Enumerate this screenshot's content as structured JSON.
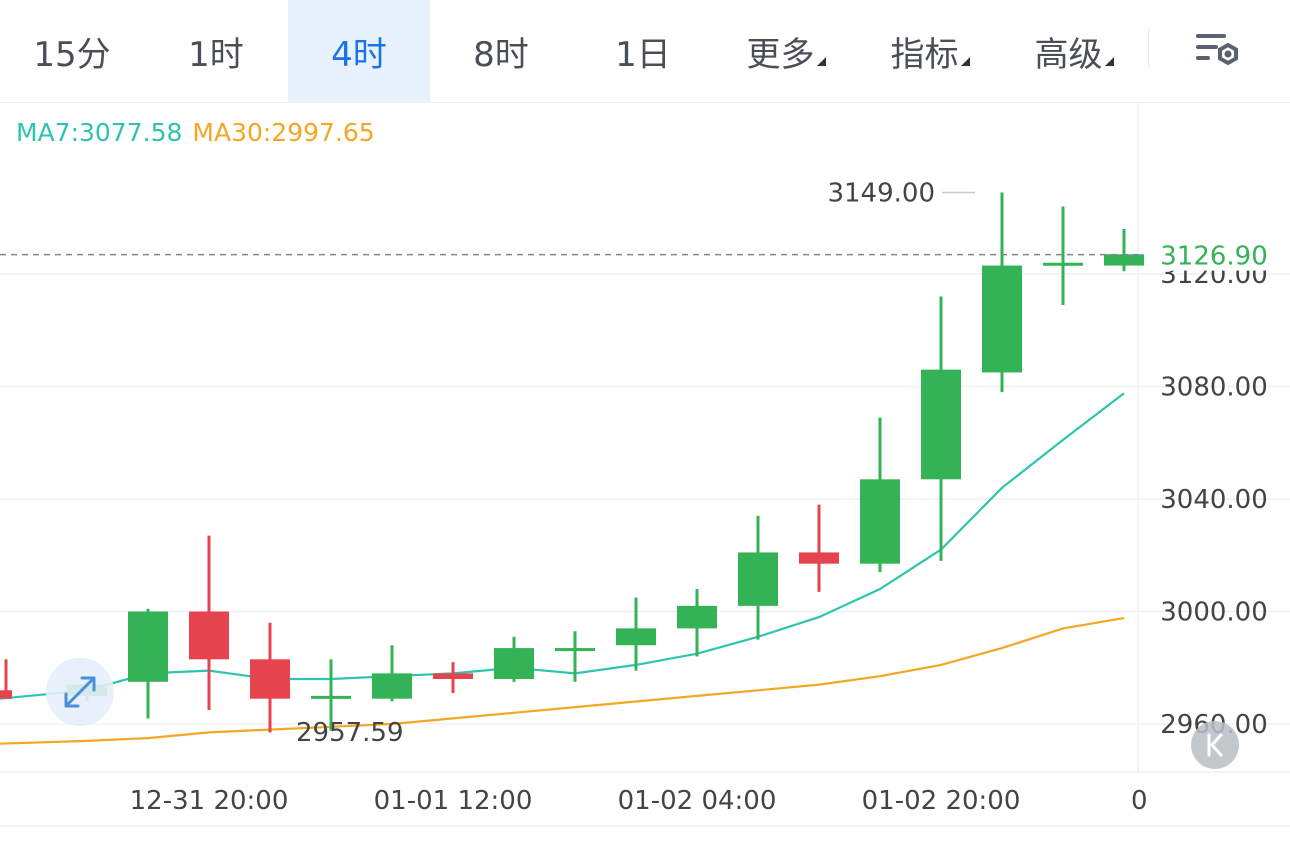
{
  "toolbar": {
    "tabs": [
      {
        "label": "15分",
        "active": false
      },
      {
        "label": "1时",
        "active": false
      },
      {
        "label": "4时",
        "active": true
      },
      {
        "label": "8时",
        "active": false
      },
      {
        "label": "1日",
        "active": false
      },
      {
        "label": "更多",
        "active": false,
        "dropdown": true
      },
      {
        "label": "指标",
        "active": false,
        "dropdown": true
      },
      {
        "label": "高级",
        "active": false,
        "dropdown": true
      }
    ],
    "settings_icon": "chart-settings-icon"
  },
  "legend": {
    "ma7": "MA7:3077.58",
    "ma30": "MA30:2997.65"
  },
  "colors": {
    "up": "#34b356",
    "down": "#e5434d",
    "ma7": "#2ec4b0",
    "ma30": "#f5a623",
    "current_price": "#34b356",
    "accent": "#1a73e8"
  },
  "chart_data": {
    "type": "candlestick",
    "x_tick_labels": [
      "12-31 20:00",
      "01-01 12:00",
      "01-02 04:00",
      "01-02 20:00",
      "0"
    ],
    "y_ticks": [
      2960,
      3000,
      3040,
      3080,
      3120
    ],
    "y_tick_labels": [
      "2960.00",
      "3000.00",
      "3040.00",
      "3080.00",
      "3120.00"
    ],
    "ylim": [
      2941,
      3168
    ],
    "current_price": 3126.9,
    "current_price_label": "3126.90",
    "high_label": "3149.00",
    "low_label": "2957.59",
    "grid": true,
    "candles": [
      {
        "o": 2972,
        "h": 2983,
        "l": 2970,
        "c": 2969
      },
      {
        "o": 2970,
        "h": 2975,
        "l": 2968,
        "c": 2974
      },
      {
        "o": 2975,
        "h": 3001,
        "l": 2962,
        "c": 3000
      },
      {
        "o": 3000,
        "h": 3027,
        "l": 2965,
        "c": 2983
      },
      {
        "o": 2983,
        "h": 2996,
        "l": 2957,
        "c": 2969
      },
      {
        "o": 2970,
        "h": 2983,
        "l": 2957.59,
        "c": 2970
      },
      {
        "o": 2969,
        "h": 2988,
        "l": 2968,
        "c": 2978
      },
      {
        "o": 2978,
        "h": 2982,
        "l": 2971,
        "c": 2976
      },
      {
        "o": 2976,
        "h": 2991,
        "l": 2975,
        "c": 2987
      },
      {
        "o": 2987,
        "h": 2993,
        "l": 2975,
        "c": 2987
      },
      {
        "o": 2988,
        "h": 3005,
        "l": 2979,
        "c": 2994
      },
      {
        "o": 2994,
        "h": 3008,
        "l": 2984,
        "c": 3002
      },
      {
        "o": 3002,
        "h": 3034,
        "l": 2990,
        "c": 3021
      },
      {
        "o": 3021,
        "h": 3038,
        "l": 3007,
        "c": 3017
      },
      {
        "o": 3017,
        "h": 3069,
        "l": 3014,
        "c": 3047
      },
      {
        "o": 3047,
        "h": 3112,
        "l": 3018,
        "c": 3086
      },
      {
        "o": 3085,
        "h": 3149,
        "l": 3078,
        "c": 3123
      },
      {
        "o": 3123,
        "h": 3144,
        "l": 3109,
        "c": 3124
      },
      {
        "o": 3123,
        "h": 3136,
        "l": 3121,
        "c": 3127
      }
    ],
    "series": [
      {
        "name": "MA7",
        "values": [
          2969,
          2972,
          2978,
          2979,
          2976,
          2976,
          2977,
          2978,
          2980,
          2978,
          2981,
          2985,
          2991,
          2998,
          3008,
          3022,
          3044,
          3061,
          3077.58
        ]
      },
      {
        "name": "MA30",
        "values": [
          2953,
          2954,
          2955,
          2957,
          2958,
          2959,
          2960,
          2962,
          2964,
          2966,
          2968,
          2970,
          2972,
          2974,
          2977,
          2981,
          2987,
          2994,
          2997.65
        ]
      }
    ]
  }
}
